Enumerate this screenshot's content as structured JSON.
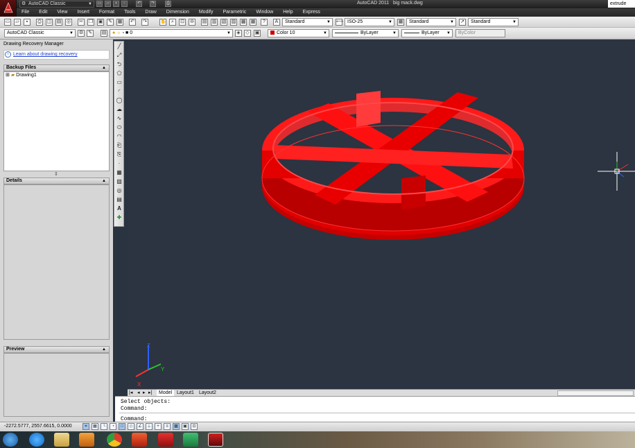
{
  "app": {
    "title": "AutoCAD 2011",
    "file": "big mack.dwg",
    "workspace": "AutoCAD Classic",
    "command_search": "extrude"
  },
  "menu": [
    "File",
    "Edit",
    "View",
    "Insert",
    "Format",
    "Tools",
    "Draw",
    "Dimension",
    "Modify",
    "Parametric",
    "Window",
    "Help",
    "Express"
  ],
  "toolbar_styles": {
    "text_style": "Standard",
    "dim_style": "ISO-25",
    "table_style": "Standard",
    "multileader_style": "Standard"
  },
  "toolbar_layers": {
    "workspace": "AutoCAD Classic",
    "layer": "0",
    "color": "Color 10",
    "linetype": "ByLayer",
    "lineweight": "ByLayer",
    "plotstyle": "ByColor"
  },
  "recovery_panel": {
    "title": "Drawing Recovery Manager",
    "learn_link": "Learn about drawing recovery",
    "backup_header": "Backup Files",
    "backup_items": [
      "Drawing1"
    ],
    "details_header": "Details",
    "preview_header": "Preview"
  },
  "layout_tabs": [
    "Model",
    "Layout1",
    "Layout2"
  ],
  "command_line": {
    "history": [
      "Select objects:",
      "Command:"
    ],
    "prompt": "Command:"
  },
  "status": {
    "coordinates": "-2272.5777, 2557.6615, 0.0000"
  },
  "ucs": {
    "x": "X",
    "y": "Y",
    "z": "Z"
  },
  "colors": {
    "model_background": "#2b3440",
    "object_color": "#ff1010",
    "accent_link": "#1c3ecf"
  }
}
